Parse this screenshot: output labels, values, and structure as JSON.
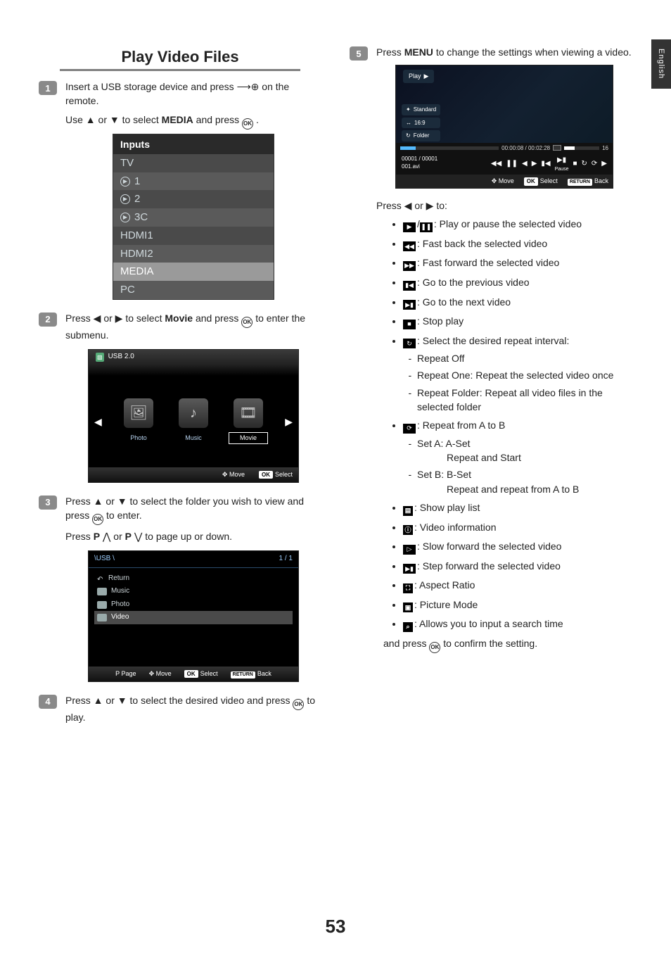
{
  "meta": {
    "language_tab": "English",
    "page_number": "53"
  },
  "title": "Play Video Files",
  "steps": {
    "s1": {
      "num": "1",
      "p1a": "Insert a USB storage device and  press ",
      "p1b": " on the remote.",
      "p2a": "Use ▲ or ▼ to select ",
      "p2_bold": "MEDIA",
      "p2b": " and press ",
      "p2c": "."
    },
    "s2": {
      "num": "2",
      "p1a": "Press ◀ or ▶ to select ",
      "p1_bold": "Movie",
      "p1b": " and press ",
      "p1c": " to enter the submenu."
    },
    "s3": {
      "num": "3",
      "p1a": "Press ▲ or ▼ to select the folder you wish to view and press ",
      "p1b": " to enter.",
      "p2a": "Press ",
      "p2_b1": "P",
      "p2_m1": " ",
      "p2_up": "⋀",
      "p2_m2": " or ",
      "p2_b2": "P",
      "p2_dn": " ⋁",
      "p2b": " to page up or down."
    },
    "s4": {
      "num": "4",
      "p1a": "Press ▲ or ▼ to select the desired video and press ",
      "p1b": " to play."
    },
    "s5": {
      "num": "5",
      "p1a": "Press ",
      "p1_bold": "MENU",
      "p1b": " to change the settings when viewing a video."
    }
  },
  "inputs_panel": {
    "header": "Inputs",
    "rows": [
      "TV",
      "1",
      "2",
      "3C",
      "HDMI1",
      "HDMI2",
      "MEDIA",
      "PC"
    ],
    "highlight_index": 6
  },
  "media_shot": {
    "usb_label": "USB 2.0",
    "tiles": [
      {
        "label": "Photo",
        "glyph": "🖼"
      },
      {
        "label": "Music",
        "glyph": "♪"
      },
      {
        "label": "Movie",
        "glyph": "🎞"
      }
    ],
    "selected_index": 2,
    "footer": {
      "move": "Move",
      "select": "Select"
    }
  },
  "browser_shot": {
    "path": "\\USB \\",
    "page": "1 / 1",
    "rows": [
      "Return",
      "Music",
      "Photo",
      "Video"
    ],
    "selected_index": 3,
    "footer": {
      "page": "Page",
      "move": "Move",
      "select": "Select",
      "back": "Back"
    }
  },
  "player_shot": {
    "play_label": "Play",
    "badges": {
      "b1": "Standard",
      "b2": "16:9",
      "b3": "Folder"
    },
    "time": "00:00:08 / 00:02:28",
    "vol_num": "16",
    "counter": "00001 / 00001",
    "filename": "001.avi",
    "control_under": "Pause",
    "footer": {
      "move": "Move",
      "select": "Select",
      "back": "Back"
    }
  },
  "right_intro": "Press ◀ or ▶ to:",
  "right_bullets": {
    "b1": ": Play or pause the selected video",
    "b2": ": Fast back the selected video",
    "b3": ": Fast forward the selected video",
    "b4": ": Go to the previous video",
    "b5": ": Go to the next video",
    "b6": ": Stop play",
    "b7": ": Select the desired repeat interval:",
    "b7_sub": {
      "a": "Repeat Off",
      "b": "Repeat One: Repeat the selected video once",
      "c": "Repeat Folder: Repeat all video files in the selected folder"
    },
    "b8": ": Repeat from A to B",
    "b8_sub": {
      "a": "Set A: A-Set",
      "a2": "Repeat and Start",
      "b": "Set B: B-Set",
      "b2": "Repeat and repeat from A to B"
    },
    "b9": ": Show play list",
    "b10": ": Video information",
    "b11": ": Slow forward the selected video",
    "b12": ": Step forward the selected video",
    "b13": ": Aspect Ratio",
    "b14": ": Picture Mode",
    "b15": ": Allows you to input a search time"
  },
  "right_outro_a": "and press ",
  "right_outro_b": " to confirm the setting.",
  "ok_label": "OK",
  "return_label": "RETURN",
  "p_label": "P"
}
